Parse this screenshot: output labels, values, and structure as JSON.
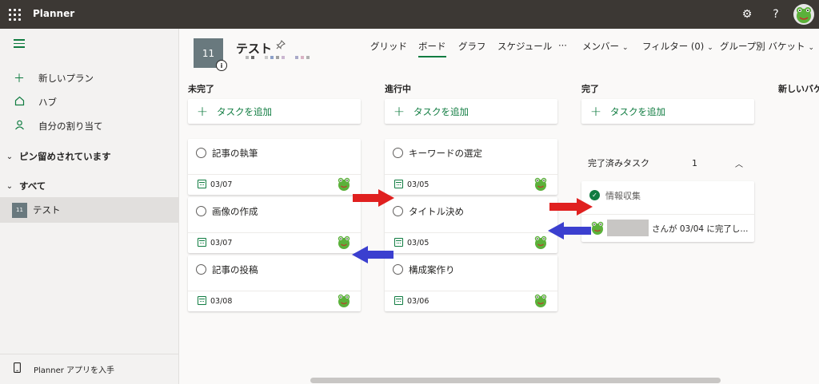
{
  "app": {
    "name": "Planner"
  },
  "topbar": {
    "settings_icon": "gear-icon",
    "help_label": "?",
    "profile_icon": "frog-avatar"
  },
  "sidebar": {
    "items": [
      {
        "label": "新しいプラン",
        "icon": "plus-icon"
      },
      {
        "label": "ハブ",
        "icon": "home-icon"
      },
      {
        "label": "自分の割り当て",
        "icon": "person-icon"
      }
    ],
    "pinned_label": "ピン留めされています",
    "all_label": "すべて",
    "plans": [
      {
        "thumb": "11",
        "label": "テスト"
      }
    ],
    "get_app_label": "Planner アプリを入手"
  },
  "plan": {
    "thumb": "11",
    "title": "テスト"
  },
  "tabs": {
    "grid": "グリッド",
    "board": "ボード",
    "chart": "グラフ",
    "schedule": "スケジュール",
    "more": "···",
    "members": "メンバー",
    "filter": "フィルター (0)",
    "group_by": "グループ別 バケット"
  },
  "add_task_label": "タスクを追加",
  "buckets": [
    {
      "title": "未完了",
      "tasks": [
        {
          "title": "記事の執筆",
          "date": "03/07"
        },
        {
          "title": "画像の作成",
          "date": "03/07"
        },
        {
          "title": "記事の投稿",
          "date": "03/08"
        }
      ]
    },
    {
      "title": "進行中",
      "tasks": [
        {
          "title": "キーワードの選定",
          "date": "03/05"
        },
        {
          "title": "タイトル決め",
          "date": "03/05"
        },
        {
          "title": "構成案作り",
          "date": "03/06"
        }
      ]
    },
    {
      "title": "完了",
      "completed_label": "完了済みタスク",
      "completed_count": "1",
      "completed_task": {
        "title": "情報収集",
        "info": "さんが 03/04 に完了し..."
      }
    },
    {
      "title": "新しいバケ"
    }
  ],
  "colors": {
    "accent": "#107c41",
    "topbar": "#3c3834",
    "red_arrow": "#e0201f",
    "blue_arrow": "#3b3fcf"
  }
}
